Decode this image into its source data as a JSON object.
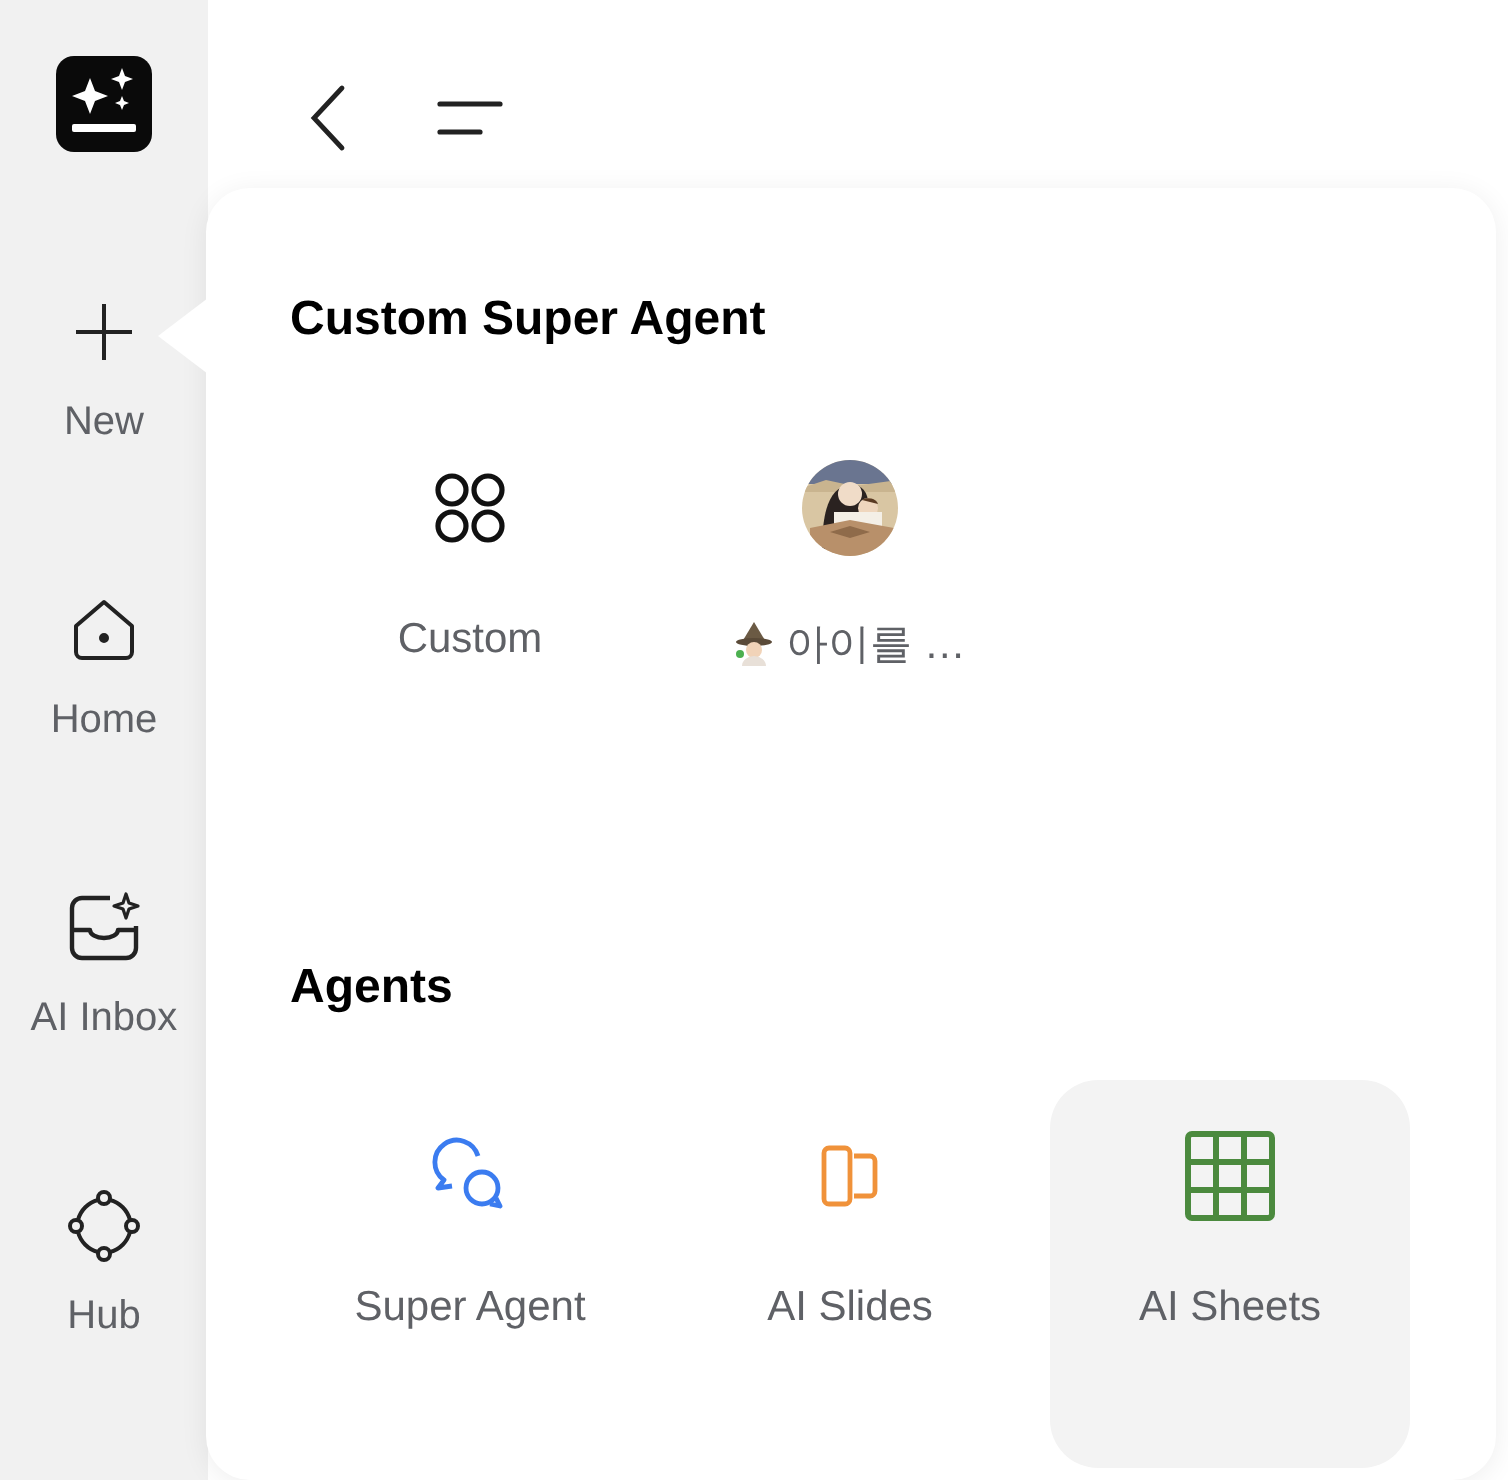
{
  "sidebar": {
    "items": [
      {
        "label": "New"
      },
      {
        "label": "Home"
      },
      {
        "label": "AI Inbox"
      },
      {
        "label": "Hub"
      }
    ]
  },
  "popover": {
    "sections": [
      {
        "title": "Custom Super Agent",
        "items": [
          {
            "kind": "icon",
            "label": "Custom",
            "selected": false
          },
          {
            "kind": "persona",
            "label": "아이를 …",
            "selected": false
          }
        ]
      },
      {
        "title": "Agents",
        "items": [
          {
            "kind": "icon",
            "label": "Super Agent",
            "selected": false
          },
          {
            "kind": "icon",
            "label": "AI Slides",
            "selected": false
          },
          {
            "kind": "icon",
            "label": "AI Sheets",
            "selected": true
          }
        ]
      }
    ]
  }
}
